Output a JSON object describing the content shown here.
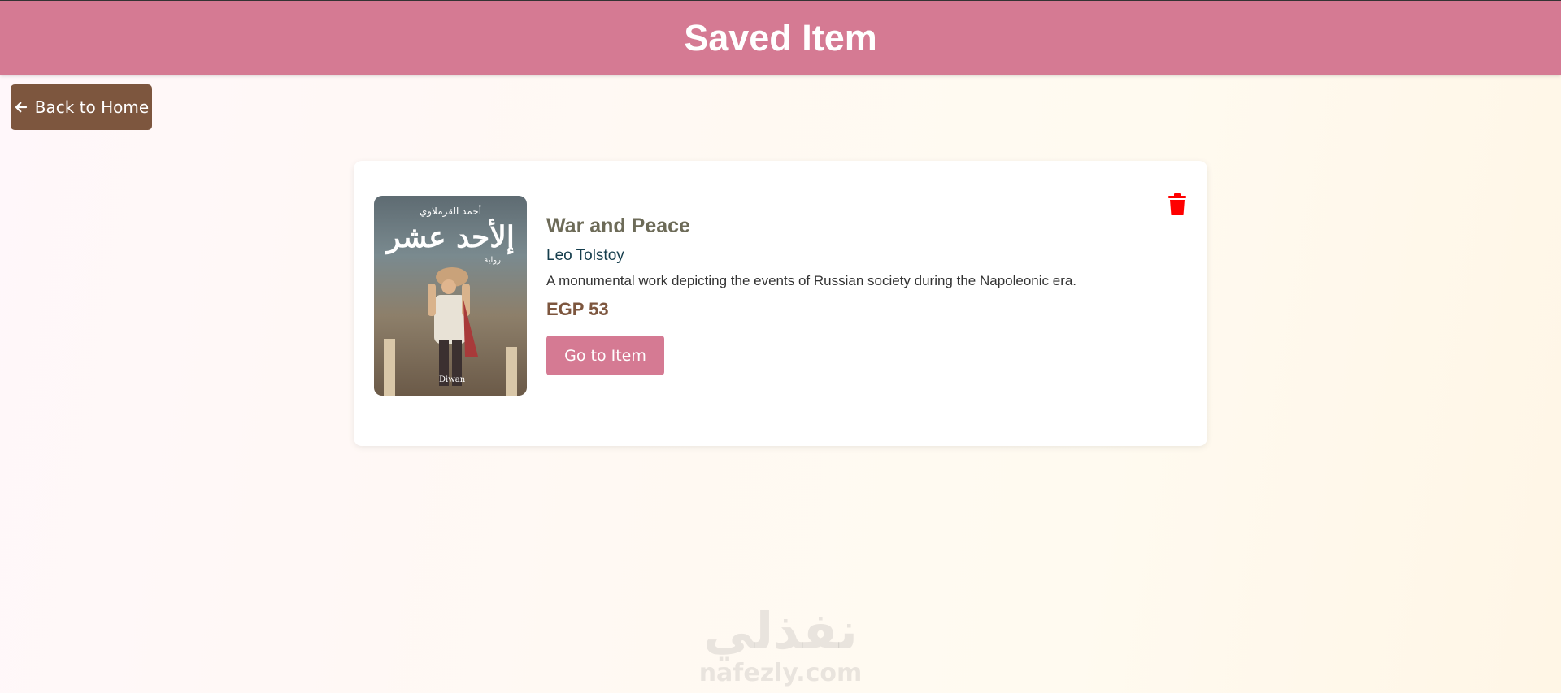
{
  "header": {
    "title": "Saved Item"
  },
  "nav": {
    "back_label": "Back to Home"
  },
  "item": {
    "cover": {
      "author_ar": "أحمد القرملاوي",
      "title_ar": "إلأحد عشر",
      "subtitle_ar": "رواية",
      "publisher": "Diwan"
    },
    "title": "War and Peace",
    "author": "Leo Tolstoy",
    "description": "A monumental work depicting the events of Russian society during the Napoleonic era.",
    "price": "EGP 53",
    "go_label": "Go to Item",
    "delete_icon": "trash-icon"
  },
  "watermark": {
    "arabic": "نفذلي",
    "url": "nafezly.com"
  },
  "colors": {
    "header": "#d57a93",
    "back_button": "#7d563e",
    "go_button": "#d57a93",
    "trash": "#ff0000",
    "price": "#7d563e"
  }
}
